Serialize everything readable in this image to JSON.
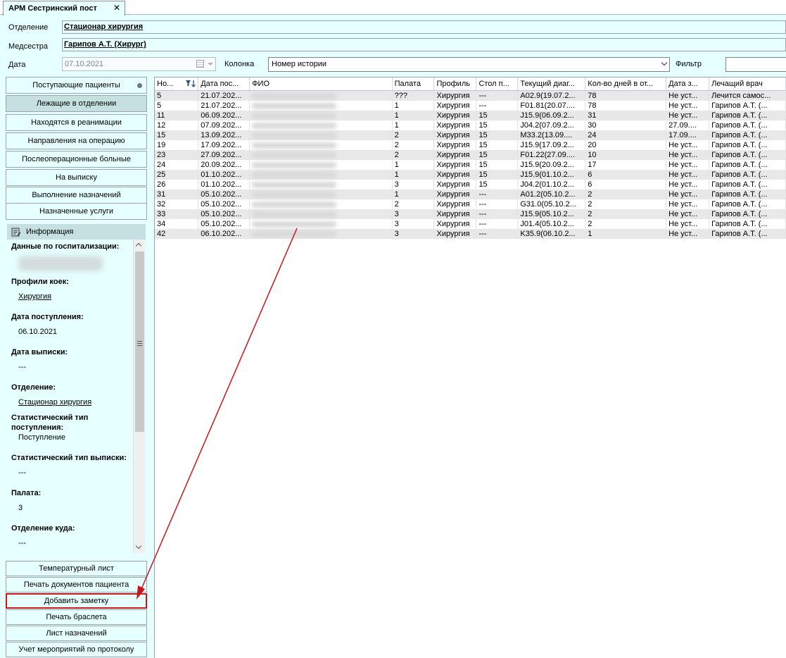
{
  "tab": {
    "title": "АРМ Сестринский пост",
    "close": "✕"
  },
  "header": {
    "department_label": "Отделение",
    "department_value": "Стационар  хирургия",
    "nurse_label": "Медсестра",
    "nurse_value": "Гарипов А.Т. (Хирург)",
    "date_label": "Дата",
    "date_value": "07.10.2021",
    "column_label": "Колонка",
    "column_value": "Номер истории",
    "filter_label": "Фильтр",
    "filter_value": ""
  },
  "nav": [
    {
      "label": "Поступающие пациенты",
      "active": false
    },
    {
      "label": "Лежащие в отделении",
      "active": true
    },
    {
      "label": "Находятся в реанимации",
      "active": false
    },
    {
      "label": "Направления на операцию",
      "active": false
    },
    {
      "label": "Послеоперационные больные",
      "active": false
    },
    {
      "label": "На выписку",
      "active": false
    },
    {
      "label": "Выполнение назначений",
      "active": false
    },
    {
      "label": "Назначенные услуги",
      "active": false
    }
  ],
  "info": {
    "header": "Информация",
    "hosp_title": "Данные по госпитализации:",
    "profiles_title": "Профили коек:",
    "profiles_value": "Хирургия",
    "admit_title": "Дата поступления:",
    "admit_value": "06.10.2021",
    "discharge_title": "Дата выписки:",
    "discharge_value": "---",
    "dept_title": "Отделение:",
    "dept_value": "Стационар  хирургия",
    "stat_admit_title": "Статистический тип поступления:",
    "stat_admit_value": "Поступление",
    "stat_discharge_title": "Статистический тип выписки:",
    "stat_discharge_value": "---",
    "ward_title": "Палата:",
    "ward_value": "3",
    "dest_title": "Отделение куда:",
    "dest_value": "---"
  },
  "bottom_buttons": [
    {
      "label": "Температурный лист"
    },
    {
      "label": "Печать документов пациента"
    },
    {
      "label": "Добавить заметку"
    },
    {
      "label": "Печать браслета"
    },
    {
      "label": "Лист назначений"
    },
    {
      "label": "Учет мероприятий по протоколу"
    }
  ],
  "table": {
    "columns": [
      "Но...",
      "Дата пос...",
      "ФИО",
      "Палата",
      "Профиль",
      "Стол п...",
      "Текущий диаг...",
      "Кол-во дней в от...",
      "Дата з...",
      "Лечащий врач"
    ],
    "rows": [
      [
        "5",
        "21.07.202...",
        "",
        "???",
        "Хирургия",
        "---",
        "A02.9(19.07.2...",
        "78",
        "Не уст...",
        "Лечится самос..."
      ],
      [
        "5",
        "21.07.202...",
        "",
        "1",
        "Хирургия",
        "---",
        "F01.81(20.07....",
        "78",
        "Не уст...",
        "Гарипов А.Т. (..."
      ],
      [
        "11",
        "06.09.202...",
        "",
        "1",
        "Хирургия",
        "15",
        "J15.9(06.09.2...",
        "31",
        "Не уст...",
        "Гарипов А.Т. (..."
      ],
      [
        "12",
        "07.09.202...",
        "",
        "1",
        "Хирургия",
        "15",
        "J04.2(07.09.2...",
        "30",
        "27.09....",
        "Гарипов А.Т. (..."
      ],
      [
        "15",
        "13.09.202...",
        "",
        "2",
        "Хирургия",
        "15",
        "M33.2(13.09....",
        "24",
        "17.09....",
        "Гарипов А.Т. (..."
      ],
      [
        "19",
        "17.09.202...",
        "",
        "2",
        "Хирургия",
        "15",
        "J15.9(17.09.2...",
        "20",
        "Не уст...",
        "Гарипов А.Т. (..."
      ],
      [
        "23",
        "27.09.202...",
        "",
        "2",
        "Хирургия",
        "15",
        "F01.22(27.09....",
        "10",
        "Не уст...",
        "Гарипов А.Т. (..."
      ],
      [
        "24",
        "20.09.202...",
        "",
        "1",
        "Хирургия",
        "15",
        "J15.9(20.09.2...",
        "17",
        "Не уст...",
        "Гарипов А.Т. (..."
      ],
      [
        "25",
        "01.10.202...",
        "",
        "1",
        "Хирургия",
        "15",
        "J15.9(01.10.2...",
        "6",
        "Не уст...",
        "Гарипов А.Т. (..."
      ],
      [
        "26",
        "01.10.202...",
        "",
        "3",
        "Хирургия",
        "15",
        "J04.2(01.10.2...",
        "6",
        "Не уст...",
        "Гарипов А.Т. (..."
      ],
      [
        "31",
        "05.10.202...",
        "",
        "1",
        "Хирургия",
        "---",
        "A01.2(05.10.2...",
        "2",
        "Не уст...",
        "Гарипов А.Т. (..."
      ],
      [
        "32",
        "05.10.202...",
        "",
        "2",
        "Хирургия",
        "---",
        "G31.0(05.10.2...",
        "2",
        "Не уст...",
        "Гарипов А.Т. (..."
      ],
      [
        "33",
        "05.10.202...",
        "",
        "3",
        "Хирургия",
        "---",
        "J15.9(05.10.2...",
        "2",
        "Не уст...",
        "Гарипов А.Т. (..."
      ],
      [
        "34",
        "05.10.202...",
        "",
        "3",
        "Хирургия",
        "---",
        "J01.4(05.10.2...",
        "2",
        "Не уст...",
        "Гарипов А.Т. (..."
      ],
      [
        "42",
        "06.10.202...",
        "",
        "3",
        "Хирургия",
        "---",
        "K35.9(06.10.2...",
        "1",
        "Не уст...",
        "Гарипов А.Т. (..."
      ]
    ]
  },
  "colors": {
    "background": "#e6ffff",
    "active_nav": "#c6dfe0",
    "highlight": "#c8161d",
    "row_alt": "#e8e8e8"
  }
}
